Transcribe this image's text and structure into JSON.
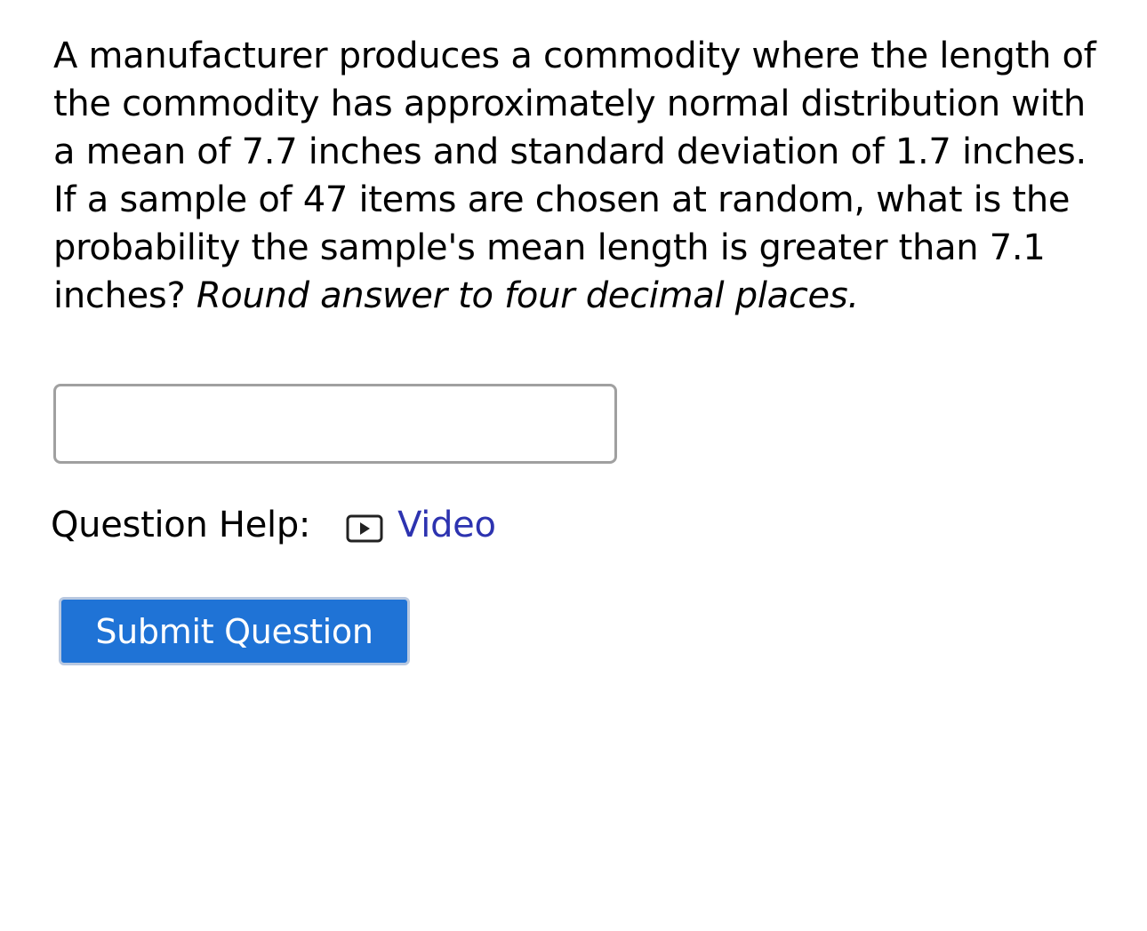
{
  "question": {
    "text": "A manufacturer produces a commodity where the length of the commodity has approximately normal distribution with a mean of 7.7 inches and standard deviation of 1.7 inches. If a sample of 47 items are chosen at random, what is the probability the sample's mean length is greater than 7.1 inches?",
    "instruction": "Round answer to four decimal places."
  },
  "answer": {
    "value": "",
    "placeholder": ""
  },
  "help": {
    "label": "Question Help:",
    "video_icon": "play-video-icon",
    "video_label": "Video",
    "link_color": "#2d33b0"
  },
  "submit": {
    "label": "Submit Question",
    "color": "#1f73d6"
  }
}
